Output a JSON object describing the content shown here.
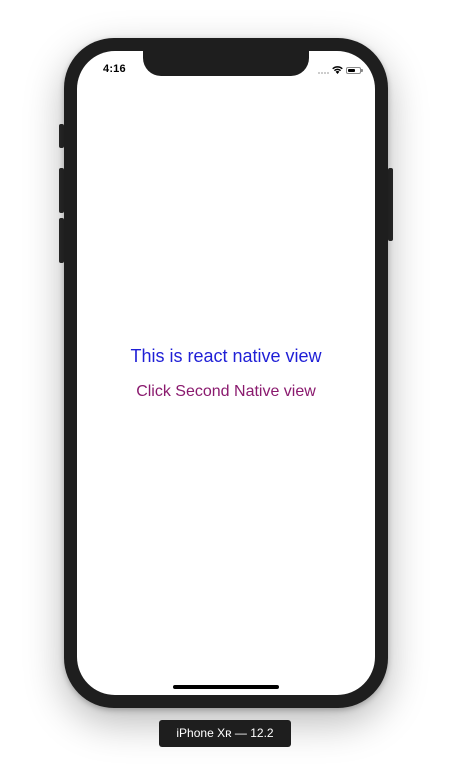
{
  "status_bar": {
    "time": "4:16",
    "battery_level": 0.6
  },
  "content": {
    "title": "This is react native view",
    "link": "Click Second Native view"
  },
  "device_label": "iPhone Xʀ — 12.2",
  "colors": {
    "title": "#1f1fd6",
    "link": "#8a1a6e",
    "bezel": "#1e1e1e"
  },
  "icons": [
    "cellular-signal-icon",
    "wifi-icon",
    "battery-icon"
  ]
}
